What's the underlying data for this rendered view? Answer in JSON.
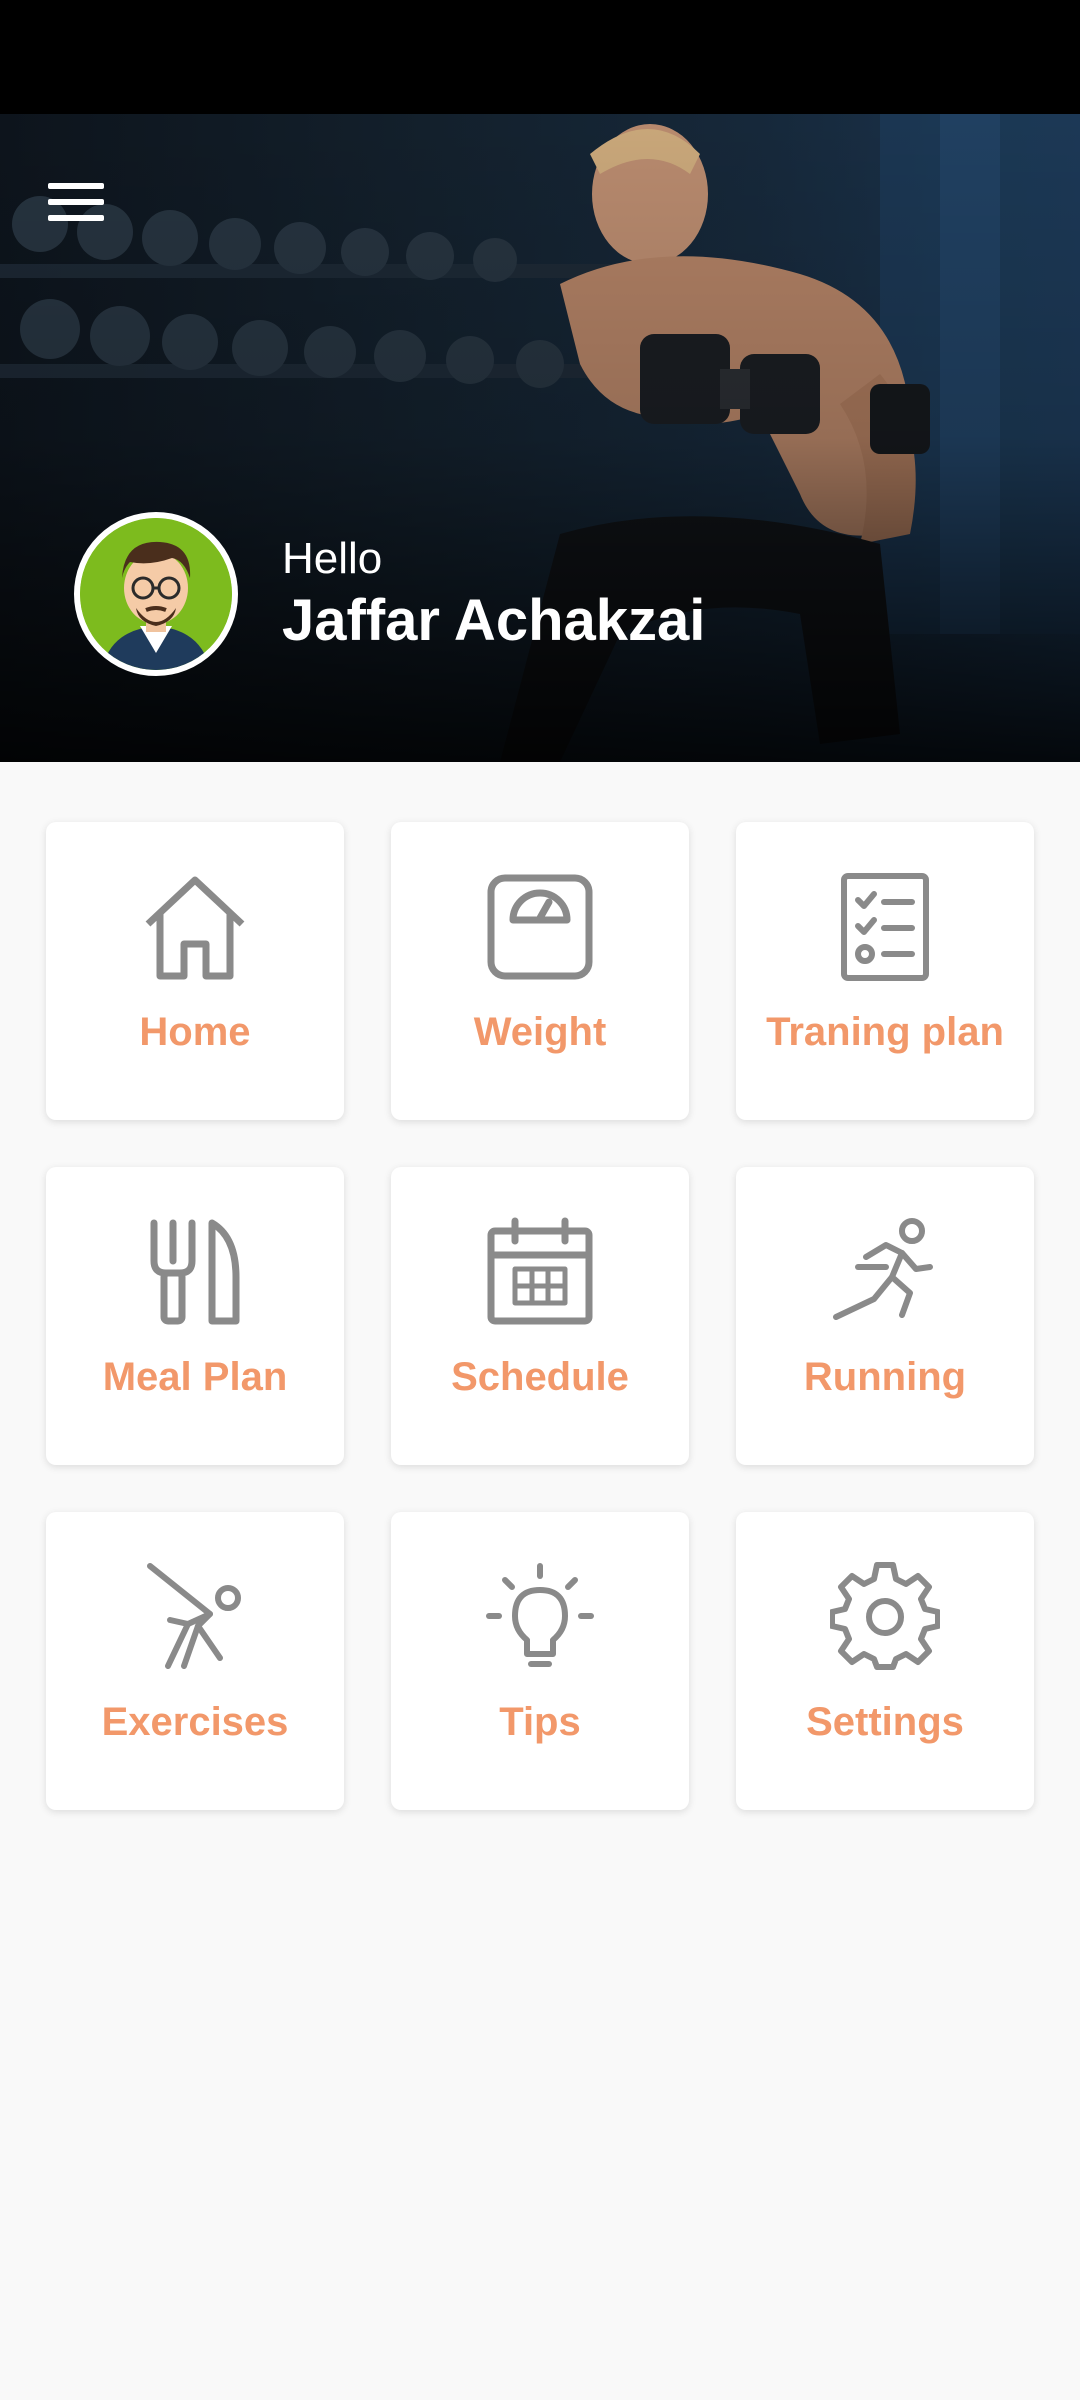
{
  "colors": {
    "accent": "#f2986a",
    "icon": "#8a8a8a",
    "tile_bg": "#ffffff",
    "page_bg": "#f9f9f9",
    "status_bar": "#000000"
  },
  "header": {
    "menu_icon": "hamburger-menu-icon",
    "greeting": "Hello",
    "user_name": "Jaffar Achakzai"
  },
  "menu": {
    "tiles": [
      {
        "label": "Home",
        "icon": "house-icon"
      },
      {
        "label": "Weight",
        "icon": "scale-icon"
      },
      {
        "label": "Traning plan",
        "icon": "checklist-icon"
      },
      {
        "label": "Meal Plan",
        "icon": "fork-knife-icon"
      },
      {
        "label": "Schedule",
        "icon": "calendar-icon"
      },
      {
        "label": "Running",
        "icon": "runner-icon"
      },
      {
        "label": "Exercises",
        "icon": "stretching-icon"
      },
      {
        "label": "Tips",
        "icon": "lightbulb-icon"
      },
      {
        "label": "Settings",
        "icon": "gear-icon"
      }
    ]
  }
}
